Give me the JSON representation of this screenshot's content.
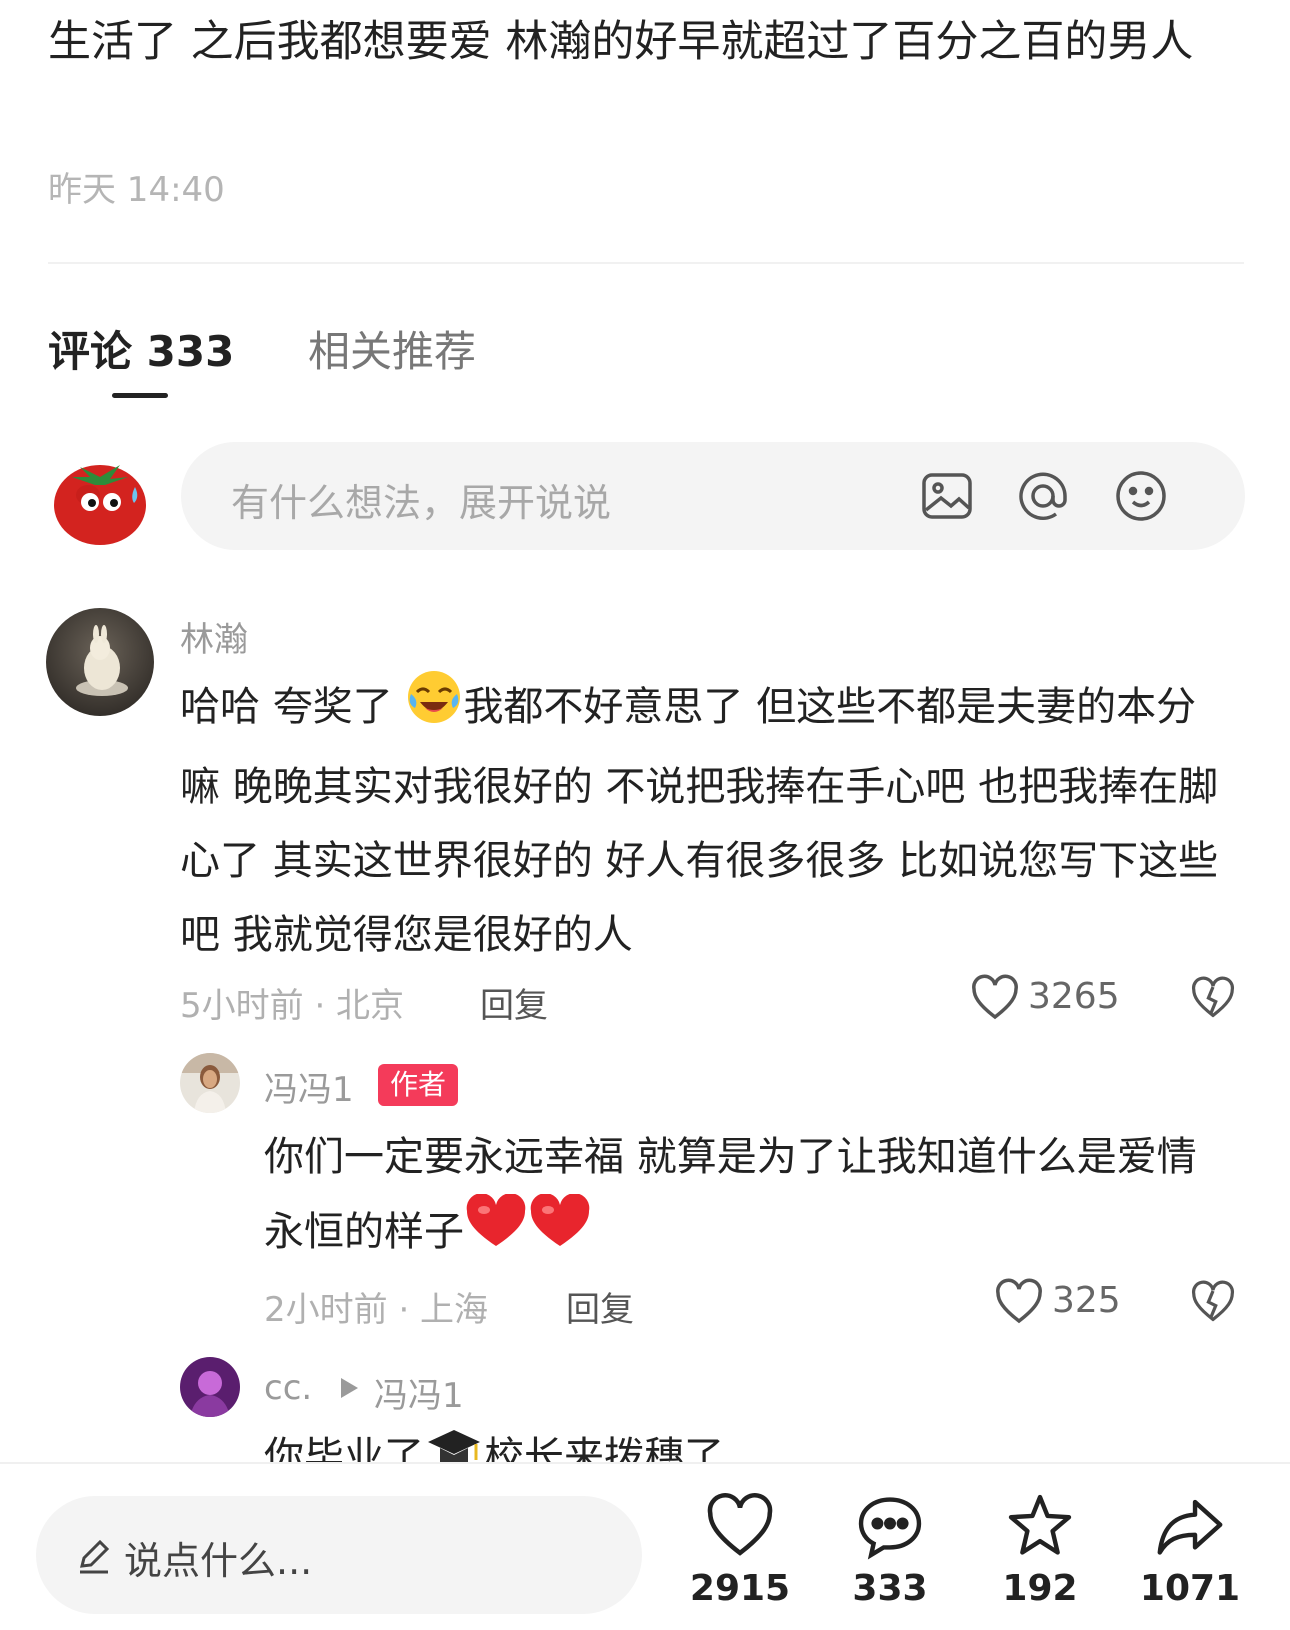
{
  "post": {
    "text": "生活了 之后我都想要爱 林瀚的好早就超过了百分之百的男人",
    "time": "昨天 14:40"
  },
  "tabs": {
    "comments_label": "评论 333",
    "related_label": "相关推荐"
  },
  "comment_input": {
    "placeholder": "有什么想法，展开说说",
    "icons": [
      "image-icon",
      "at-icon",
      "emoji-icon"
    ]
  },
  "comments": [
    {
      "username": "林瀚",
      "text_parts": [
        "哈哈 夸奖了 ",
        "我都不好意思了 但这些不都是夫妻的本分嘛 晚晚其实对我很好的 不说把我捧在手心吧 也把我捧在脚心了 其实这世界很好的 好人有很多很多 比如说您写下这些吧 我就觉得您是很好的人"
      ],
      "emoji": "crying-laughing",
      "meta": "5小时前 · 北京",
      "reply": "回复",
      "likes": "3265",
      "replies": [
        {
          "username": "冯冯1",
          "badge": "作者",
          "text": "你们一定要永远幸福 就算是为了让我知道什么是爱情永恒的样子",
          "emoji": "red-heart x2",
          "meta": "2小时前 · 上海",
          "reply": "回复",
          "likes": "325"
        },
        {
          "username": "cc.",
          "reply_to": "冯冯1",
          "text_partial": "你毕业了",
          "text_partial2": "校长来拨穗了"
        }
      ]
    }
  ],
  "bottom_bar": {
    "say_placeholder": "说点什么...",
    "likes": "2915",
    "comments": "333",
    "favorites": "192",
    "shares": "1071"
  },
  "colors": {
    "badge": "#f43b5a",
    "heart_emoji": "#e8252d",
    "tab_active": "#222222"
  }
}
